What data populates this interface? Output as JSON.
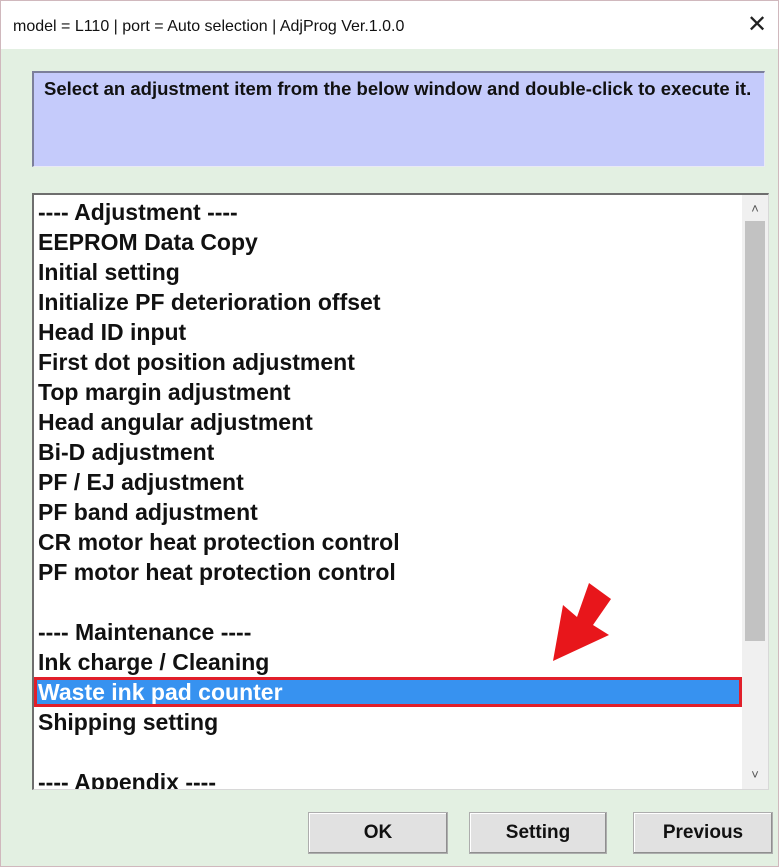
{
  "window": {
    "title": "model = L110 | port = Auto selection | AdjProg Ver.1.0.0",
    "close_glyph": "✕"
  },
  "instruction": "Select an adjustment item from the below window and double-click to execute it.",
  "list": {
    "items": [
      "---- Adjustment ----",
      "EEPROM Data Copy",
      "Initial setting",
      "Initialize PF deterioration offset",
      "Head ID input",
      "First dot position adjustment",
      "Top margin adjustment",
      "Head angular adjustment",
      "Bi-D adjustment",
      "PF / EJ adjustment",
      "PF band adjustment",
      "CR motor heat protection control",
      "PF motor heat protection control",
      "",
      "---- Maintenance ----",
      "Ink charge / Cleaning",
      "Waste ink pad counter",
      "Shipping setting",
      "",
      "---- Appendix ----"
    ],
    "selected_item": "Waste ink pad counter"
  },
  "scrollbar": {
    "up_glyph": "˄",
    "down_glyph": "˅"
  },
  "buttons": {
    "ok": "OK",
    "setting": "Setting",
    "previous": "Previous"
  },
  "colors": {
    "selection": "#3792f0",
    "highlight_border": "#e11f2a",
    "arrow": "#e8161b",
    "instruction_bg": "#c5cbfb",
    "window_bg": "#e3f0e2"
  }
}
